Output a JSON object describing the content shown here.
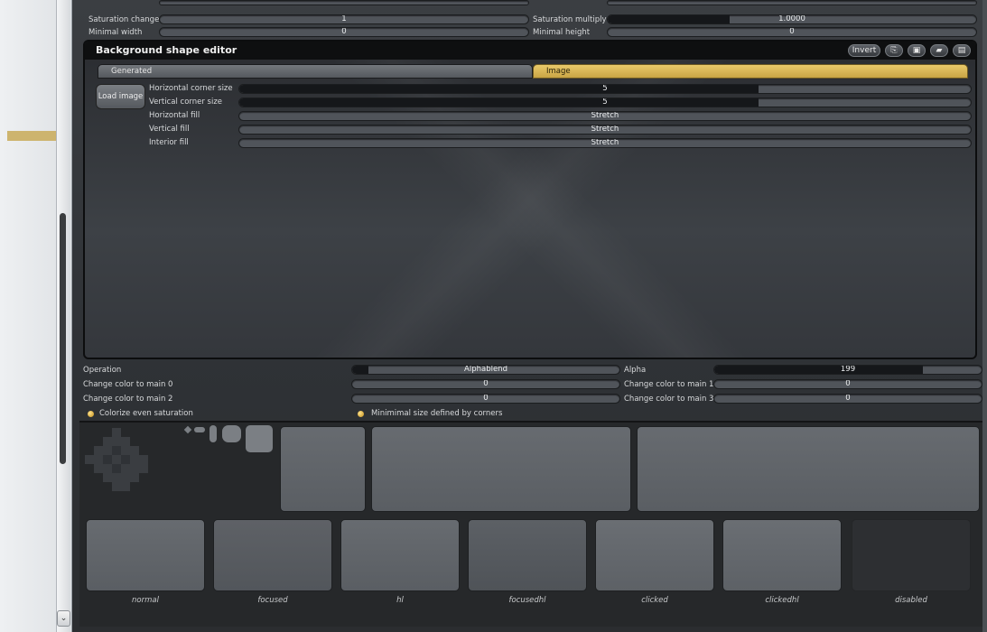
{
  "top_rows": [
    {
      "left_label": "Saturation change",
      "left_value": "1",
      "right_label": "Saturation multiply",
      "right_value": "1.0000"
    },
    {
      "left_label": "Minimal width",
      "left_value": "0",
      "right_label": "Minimal height",
      "right_value": "0"
    }
  ],
  "editor": {
    "title": "Background shape editor",
    "toolbar": {
      "invert_label": "Invert"
    },
    "tabs": [
      {
        "label": "Generated"
      },
      {
        "label": "Image"
      }
    ],
    "load_image_label": "Load image",
    "props": [
      {
        "label": "Horizontal corner size",
        "value": "5",
        "fill": 0.71
      },
      {
        "label": "Vertical corner size",
        "value": "5",
        "fill": 0.71
      },
      {
        "label": "Horizontal fill",
        "value": "Stretch"
      },
      {
        "label": "Vertical fill",
        "value": "Stretch"
      },
      {
        "label": "Interior fill",
        "value": "Stretch"
      }
    ]
  },
  "ops": {
    "operation_label": "Operation",
    "operation_value": "Alphablend",
    "alpha_label": "Alpha",
    "alpha_value": "199",
    "main0_label": "Change color to main 0",
    "main0_value": "0",
    "main1_label": "Change color to main 1",
    "main1_value": "0",
    "main2_label": "Change color to main 2",
    "main2_value": "0",
    "main3_label": "Change color to main 3",
    "main3_value": "0",
    "colorize_label": "Colorize even saturation",
    "minsize_label": "Minimimal size defined by corners"
  },
  "states": [
    "normal",
    "focused",
    "hl",
    "focusedhl",
    "clicked",
    "clickedhl",
    "disabled"
  ],
  "colors": {
    "accent": "#cdb46e",
    "tab_active": "#d9b653"
  }
}
